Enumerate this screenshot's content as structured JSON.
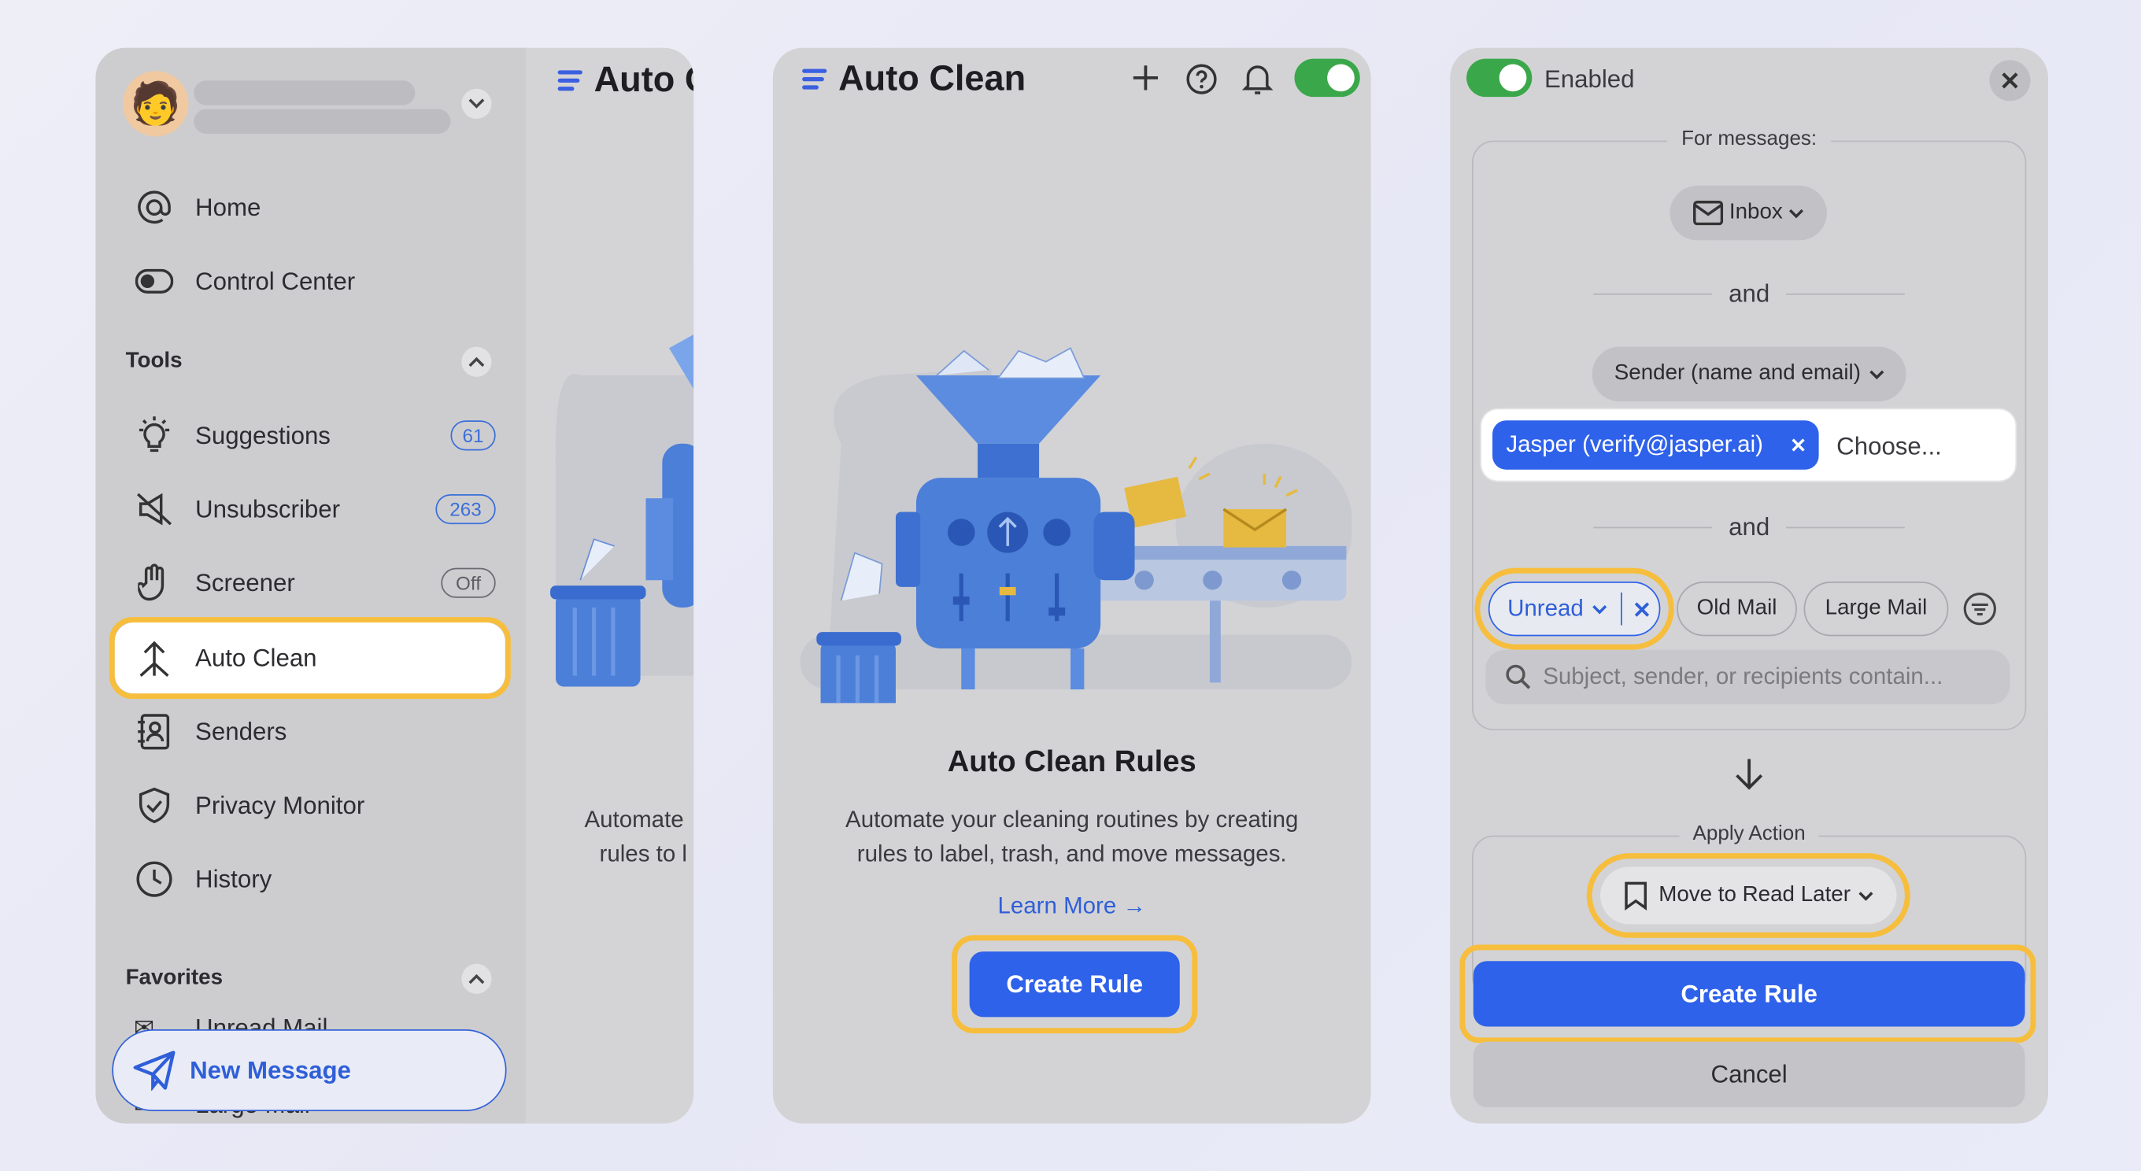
{
  "panel1": {
    "profile": {
      "avatar_emoji": "🧑"
    },
    "header_peek_title": "Auto Clean",
    "nav": [
      {
        "label": "Home",
        "icon": "at-sign-icon"
      },
      {
        "label": "Control Center",
        "icon": "toggle-icon"
      }
    ],
    "tools_section": "Tools",
    "tools": [
      {
        "label": "Suggestions",
        "icon": "lightbulb-icon",
        "badge": "61"
      },
      {
        "label": "Unsubscriber",
        "icon": "mute-megaphone-icon",
        "badge": "263"
      },
      {
        "label": "Screener",
        "icon": "hand-icon",
        "badge": "Off"
      },
      {
        "label": "Auto Clean",
        "icon": "auto-clean-icon"
      },
      {
        "label": "Senders",
        "icon": "contacts-icon"
      },
      {
        "label": "Privacy Monitor",
        "icon": "shield-check-icon"
      },
      {
        "label": "History",
        "icon": "clock-icon"
      }
    ],
    "favorites_section": "Favorites",
    "favorites_peek": [
      "Unread Mail",
      "Large Mail"
    ],
    "new_message": "New Message",
    "peek_desc_line1": "Automate",
    "peek_desc_line2": "rules to l"
  },
  "panel2": {
    "title": "Auto Clean",
    "heading": "Auto Clean Rules",
    "desc_line1": "Automate your cleaning routines by creating",
    "desc_line2": "rules to label, trash, and move messages.",
    "learn_more": "Learn More →",
    "create_rule": "Create Rule"
  },
  "panel3": {
    "enabled_label": "Enabled",
    "for_messages": "For messages:",
    "mailbox": "Inbox",
    "and1": "and",
    "sender_field": "Sender (name and email)",
    "sender_chip": "Jasper (verify@jasper.ai)",
    "sender_placeholder": "Choose...",
    "and2": "and",
    "filters": [
      "Unread",
      "Old Mail",
      "Large Mail"
    ],
    "search_placeholder": "Subject, sender, or recipients contain...",
    "apply_action": "Apply Action",
    "action": "Move to Read Later",
    "create_rule": "Create Rule",
    "cancel": "Cancel"
  },
  "colors": {
    "accent": "#2f62ea",
    "highlight": "#f6be3c",
    "toggle_on": "#3aa84a"
  }
}
